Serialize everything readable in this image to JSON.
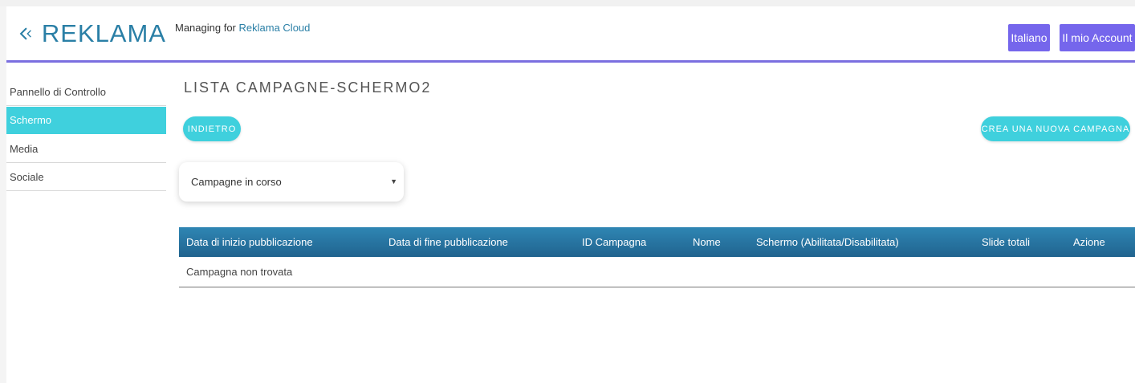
{
  "brand": {
    "name": "REKLAMA",
    "icon": "reklama-logo-icon",
    "color": "#2a7fa6"
  },
  "header": {
    "managing_prefix": "Managing for",
    "organization": "Reklama Cloud",
    "language_button": "Italiano",
    "account_button": "Il mio Account",
    "accent": "#7566ec"
  },
  "sidebar": {
    "items": [
      {
        "label": "Pannello di Controllo",
        "active": false
      },
      {
        "label": "Schermo",
        "active": true
      },
      {
        "label": "Media",
        "active": false
      },
      {
        "label": "Sociale",
        "active": false
      }
    ],
    "active_color": "#3fd0dd"
  },
  "main": {
    "title": "LISTA CAMPAGNE-SCHERMO2",
    "back_button": "INDIETRO",
    "new_campaign_button": "CREA UNA NUOVA CAMPAGNA",
    "filter": {
      "selected": "Campagne in corso"
    },
    "table": {
      "columns": [
        "Data di inizio pubblicazione",
        "Data di fine pubblicazione",
        "ID Campagna",
        "Nome",
        "Schermo (Abilitata/Disabilitata)",
        "Slide totali",
        "Azione"
      ],
      "empty_message": "Campagna non trovata"
    }
  }
}
